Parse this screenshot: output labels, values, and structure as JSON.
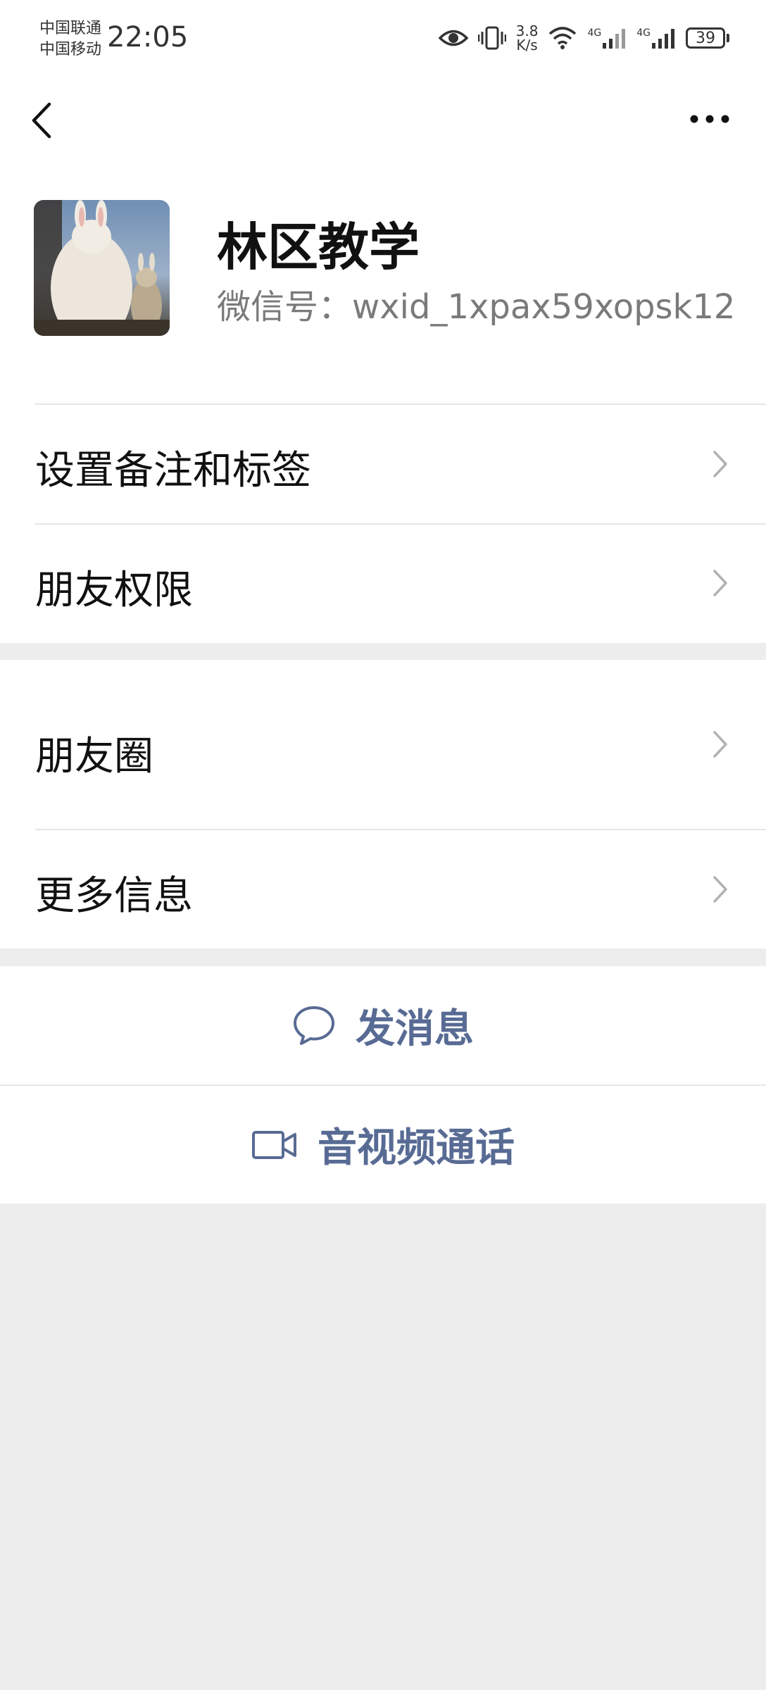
{
  "status_bar": {
    "carrier_1": "中国联通",
    "carrier_2": "中国移动",
    "time": "22:05",
    "net_speed_value": "3.8",
    "net_speed_unit": "K/s",
    "network_1": "4G",
    "network_2": "4G",
    "battery_level": "39",
    "icons": [
      "eye-icon",
      "vibrate-icon",
      "wifi-icon",
      "signal-icon",
      "battery-icon"
    ]
  },
  "nav": {
    "back_icon": "chevron-left-icon",
    "more_icon": "more-horizontal-icon"
  },
  "profile": {
    "name": "林区教学",
    "wechat_id": "微信号：wxid_1xpax59xopsk12"
  },
  "menu": {
    "items": [
      {
        "label": "设置备注和标签"
      },
      {
        "label": "朋友权限"
      },
      {
        "label": "朋友圈"
      },
      {
        "label": "更多信息"
      }
    ]
  },
  "actions": {
    "send_message": "发消息",
    "av_call": "音视频通话"
  },
  "colors": {
    "accent": "#586b94",
    "background": "#ededed",
    "card": "#ffffff"
  }
}
